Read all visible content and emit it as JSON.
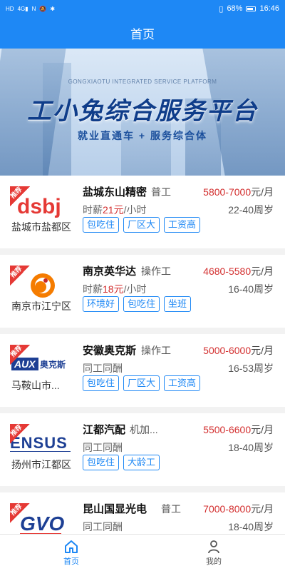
{
  "status_bar": {
    "left_icons": [
      "HD",
      "4G",
      "NFC",
      "N",
      "silent",
      "bluetooth"
    ],
    "battery_percent": "68%",
    "time": "16:46"
  },
  "header": {
    "title": "首页"
  },
  "banner": {
    "subtitle": "GONGXIAOTU INTEGRATED SERVICE PLATFORM",
    "title": "工小兔综合服务平台",
    "slogan": "就业直通车 + 服务综合体"
  },
  "ribbon_label": "推荐",
  "jobs": [
    {
      "logo": "dsbj",
      "company": "盐城东山精密",
      "position": "普工",
      "salary_range": "5800-7000",
      "salary_unit": "元/月",
      "pay_prefix": "时薪",
      "pay_value": "21元",
      "pay_suffix": "/小时",
      "age": "22-40周岁",
      "location": "盐城市盐都区",
      "tags": [
        "包吃住",
        "厂区大",
        "工资高"
      ]
    },
    {
      "logo": "yingwhuada",
      "company": "南京英华达",
      "position": "操作工",
      "salary_range": "4680-5580",
      "salary_unit": "元/月",
      "pay_prefix": "时薪",
      "pay_value": "18元",
      "pay_suffix": "/小时",
      "age": "16-40周岁",
      "location": "南京市江宁区",
      "tags": [
        "环境好",
        "包吃住",
        "坐班"
      ]
    },
    {
      "logo": "AUX 奥克斯",
      "company": "安徽奥克斯",
      "position": "操作工",
      "salary_range": "5000-6000",
      "salary_unit": "元/月",
      "pay_prefix": "同工同酬",
      "pay_value": "",
      "pay_suffix": "",
      "age": "16-53周岁",
      "location": "马鞍山市...",
      "tags": [
        "包吃住",
        "厂区大",
        "工资高"
      ]
    },
    {
      "logo": "ENSUS",
      "company": "江都汽配",
      "position": "机加...",
      "salary_range": "5500-6600",
      "salary_unit": "元/月",
      "pay_prefix": "同工同酬",
      "pay_value": "",
      "pay_suffix": "",
      "age": "18-40周岁",
      "location": "扬州市江都区",
      "tags": [
        "包吃住",
        "大龄工"
      ]
    },
    {
      "logo": "GVO",
      "company": "昆山国显光电",
      "position": "普工",
      "salary_range": "7000-8000",
      "salary_unit": "元/月",
      "pay_prefix": "同工同酬",
      "pay_value": "",
      "pay_suffix": "",
      "age": "18-40周岁",
      "location": "",
      "tags": []
    }
  ],
  "bottom_nav": {
    "home_label": "首页",
    "mine_label": "我的"
  },
  "colors": {
    "primary": "#1e88f5",
    "salary_red": "#d32f2f"
  }
}
